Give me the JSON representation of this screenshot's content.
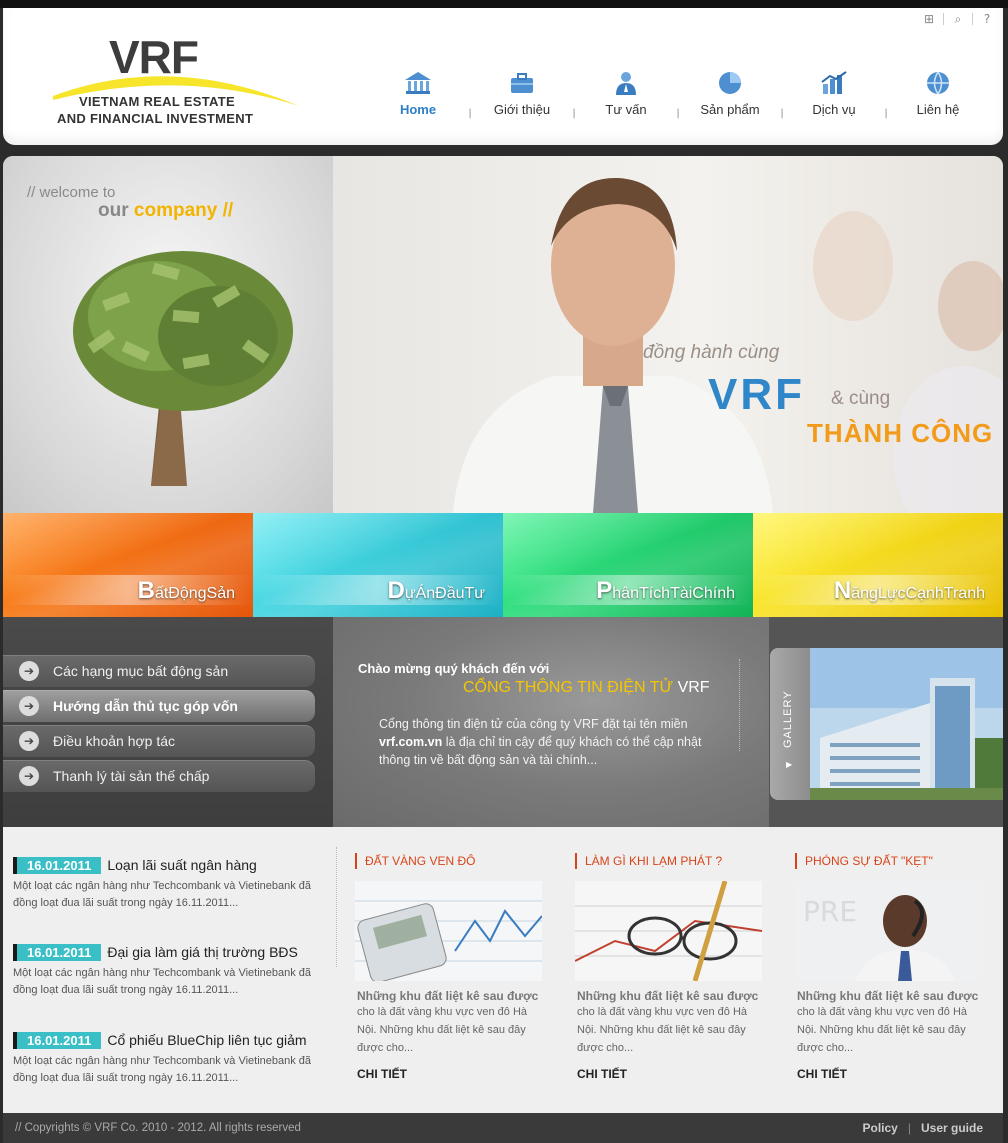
{
  "header": {
    "brand": "VRF",
    "tagline_line1": "VIETNAM REAL ESTATE",
    "tagline_line2": "AND FINANCIAL INVESTMENT",
    "tools": [
      "sitemap-icon",
      "search-icon",
      "help-icon"
    ]
  },
  "nav": {
    "items": [
      {
        "label": "Home",
        "icon": "home-icon",
        "active": true
      },
      {
        "label": "Giới thiệu",
        "icon": "briefcase-icon"
      },
      {
        "label": "Tư vấn",
        "icon": "advisor-icon"
      },
      {
        "label": "Sản phẩm",
        "icon": "pie-chart-icon"
      },
      {
        "label": "Dịch vụ",
        "icon": "bar-chart-icon"
      },
      {
        "label": "Liên hệ",
        "icon": "globe-icon"
      }
    ]
  },
  "hero": {
    "welcome": "// welcome to",
    "company_a": "our",
    "company_b": "company //",
    "slogan1": "đồng hành cùng",
    "slogan2": "VRF",
    "slogan3": "& cùng",
    "slogan4": "THÀNH CÔNG"
  },
  "tiles": [
    {
      "initial": "B",
      "rest": "ấtĐộngSản",
      "color": "#f06a14"
    },
    {
      "initial": "D",
      "rest": "ựÁnĐầuTư",
      "color": "#2cc6d6"
    },
    {
      "initial": "P",
      "rest": "hânTíchTàiChính",
      "color": "#22d36e"
    },
    {
      "initial": "N",
      "rest": "ăngLựcCạnhTranh",
      "color": "#f4dc12"
    }
  ],
  "menu": {
    "items": [
      {
        "label": "Các hạng mục bất động sản"
      },
      {
        "label": "Hướng dẫn thủ tục góp vốn",
        "active": true
      },
      {
        "label": "Điều khoản hợp tác"
      },
      {
        "label": "Thanh lý tài sản thế chấp"
      }
    ]
  },
  "welcome_box": {
    "line1": "Chào mừng quý khách đến với",
    "line2": "CỔNG THÔNG TIN ĐIỆN TỬ",
    "line2_brand": "VRF",
    "body_pre": "Cổng thông tin điện tử của công ty VRF đặt tại tên miền",
    "domain": "vrf.com.vn",
    "body_post": "là địa chỉ tin cậy để quý khách có thể cập nhật thông tin về bất động sản và tài chính..."
  },
  "gallery": {
    "label": "GALLERY"
  },
  "news": [
    {
      "date": "16.01.2011",
      "title": "Loạn lãi suất ngân hàng",
      "desc": "Một loạt các ngân hàng như Techcombank và Vietinebank đã đồng loạt đua lãi suất trong ngày 16.11.2011..."
    },
    {
      "date": "16.01.2011",
      "title": "Đại gia làm giá thị trường BĐS",
      "desc": "Một loạt các ngân hàng như Techcombank và Vietinebank đã đồng loạt đua lãi suất trong ngày 16.11.2011..."
    },
    {
      "date": "16.01.2011",
      "title": "Cổ phiếu BlueChip liên tục giảm",
      "desc": "Một loạt các ngân hàng như Techcombank và Vietinebank đã đồng loạt đua lãi suất trong ngày 16.11.2011..."
    }
  ],
  "columns": [
    {
      "heading": "ĐẤT VÀNG VEN ĐÔ",
      "caption": "Những khu đất liệt kê sau  được",
      "text": "cho là đất vàng khu vực ven đô Hà Nội. Những khu đất liệt kê sau đây được cho...",
      "more": "CHI TIẾT"
    },
    {
      "heading": "LÀM GÌ KHI LẠM PHÁT ?",
      "caption": "Những khu đất liệt kê sau  được",
      "text": "cho là đất vàng khu vực ven đô Hà Nội. Những khu đất liệt kê sau đây được cho...",
      "more": "CHI TIẾT"
    },
    {
      "heading": "PHÓNG SỰ ĐẤT \"KẸT\"",
      "caption": "Những khu đất liệt kê sau  được",
      "text": "cho là đất vàng khu vực ven đô Hà Nội. Những khu đất liệt kê sau đây được cho...",
      "more": "CHI TIẾT"
    }
  ],
  "footer": {
    "copyright": "//  Copyrights © VRF Co. 2010 - 2012. All rights reserved",
    "policy": "Policy",
    "sep": "|",
    "guide": "User guide"
  }
}
